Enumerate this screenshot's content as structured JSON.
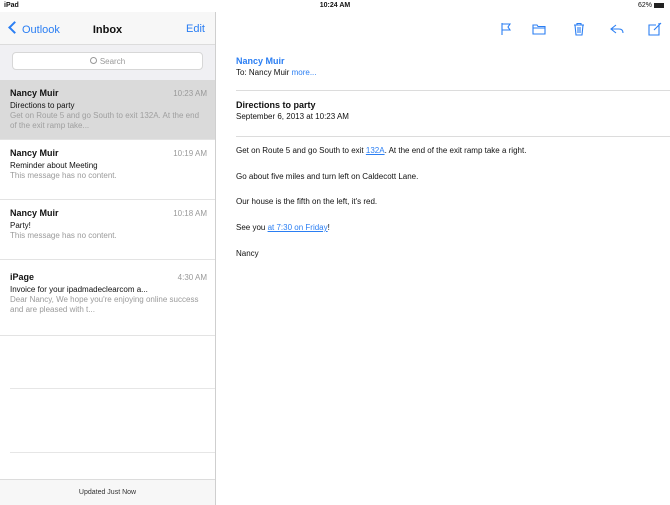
{
  "status": {
    "left": "iPad",
    "time": "10:24 AM",
    "right": "62%"
  },
  "nav": {
    "back_label": "Outlook",
    "title": "Inbox",
    "edit_label": "Edit"
  },
  "search": {
    "placeholder": "Search"
  },
  "messages": [
    {
      "sender": "Nancy Muir",
      "time": "10:23 AM",
      "subject": "Directions to party",
      "preview": "Get on Route 5 and go South to exit 132A. At the end of the exit ramp take..."
    },
    {
      "sender": "Nancy Muir",
      "time": "10:19 AM",
      "subject": "Reminder about Meeting",
      "preview": "This message has no content."
    },
    {
      "sender": "Nancy Muir",
      "time": "10:18 AM",
      "subject": "Party!",
      "preview": "This message has no content."
    },
    {
      "sender": "iPage",
      "time": "4:30 AM",
      "subject": "Invoice for your ipadmadeclearcom a...",
      "preview": "Dear Nancy, We hope you're enjoying online success and are pleased with t..."
    }
  ],
  "footer": {
    "label": "Updated Just Now"
  },
  "toolbar": {
    "icons": [
      "flag-icon",
      "folder-icon",
      "trash-icon",
      "reply-icon",
      "compose-icon"
    ]
  },
  "email": {
    "sender": "Nancy Muir",
    "to_prefix": "To: Nancy Muir",
    "to_more": "more...",
    "subject": "Directions to party",
    "date": "September 6, 2013 at 10:23 AM",
    "line1_a": "Get on Route 5 and go South to exit ",
    "line1_link": "132A",
    "line1_b": ". At the end of the exit ramp take a right.",
    "line2": "Go about five miles and turn left on Caldecott Lane.",
    "line3": "Our house is the fifth on the left, it's red.",
    "line4_a": "See you ",
    "line4_link": "at 7:30 on Friday",
    "line4_b": "!",
    "line5": "Nancy"
  },
  "colors": {
    "accent": "#2a7ef3",
    "selected_row": "#dadada"
  }
}
